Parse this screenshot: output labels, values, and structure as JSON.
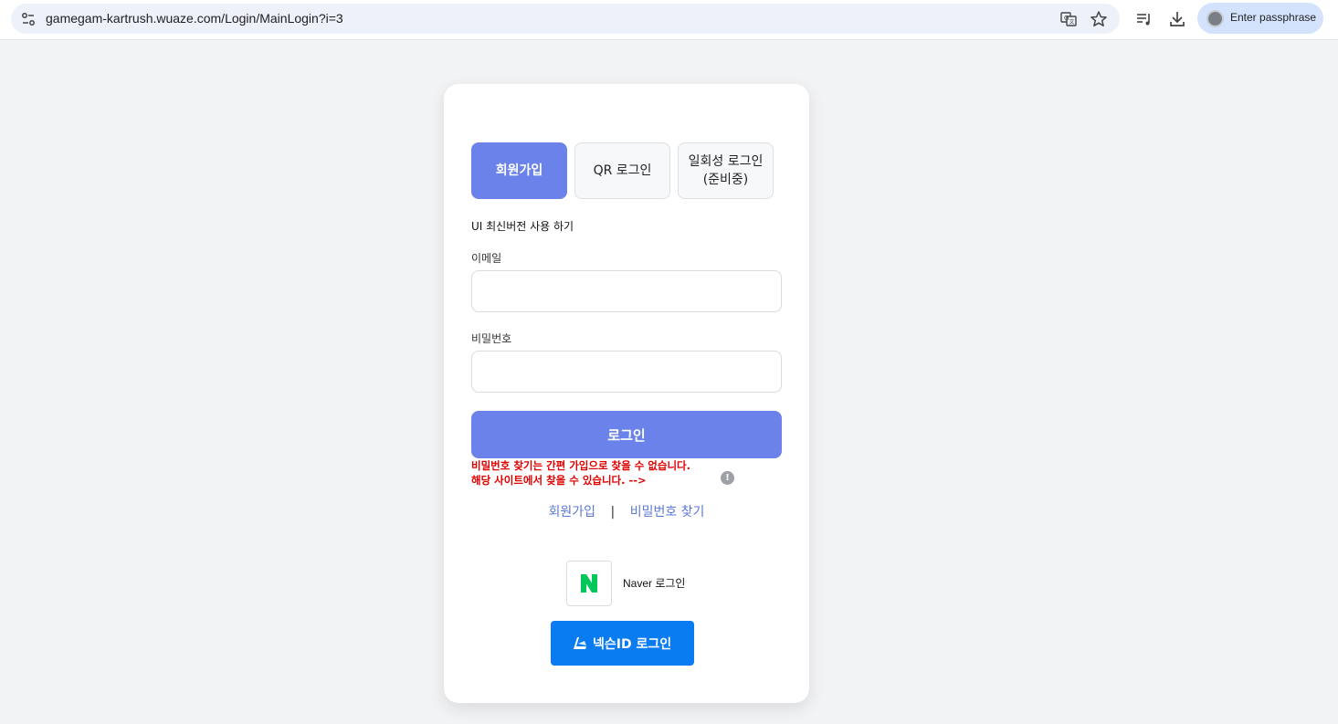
{
  "browser": {
    "url": "gamegam-kartrush.wuaze.com/Login/MainLogin?i=3",
    "profile_label": "Enter passphrase"
  },
  "tabs": [
    {
      "label": "회원가입"
    },
    {
      "label": "QR 로그인"
    },
    {
      "label": "일회성 로그인\n(준비중)"
    }
  ],
  "ui_toggle": "UI 최신버전 사용 하기",
  "form": {
    "email_label": "이메일",
    "password_label": "비밀번호",
    "login_button": "로그인"
  },
  "notice": {
    "line1": "비밀번호 찾기는 간편 가입으로 찾을 수 없습니다.",
    "line2": "해당 사이트에서 찾을 수 있습니다. -->",
    "info_icon": "!"
  },
  "links": {
    "signup": "회원가입",
    "separator": "|",
    "find_password": "비밀번호 찾기"
  },
  "social": {
    "naver_label": "Naver 로그인",
    "nexon_label": "넥슨ID 로그인"
  },
  "colors": {
    "accent": "#6b82eb",
    "notice": "#e00000",
    "naver_green": "#03c75a",
    "nexon_blue": "#0a7cf2"
  }
}
